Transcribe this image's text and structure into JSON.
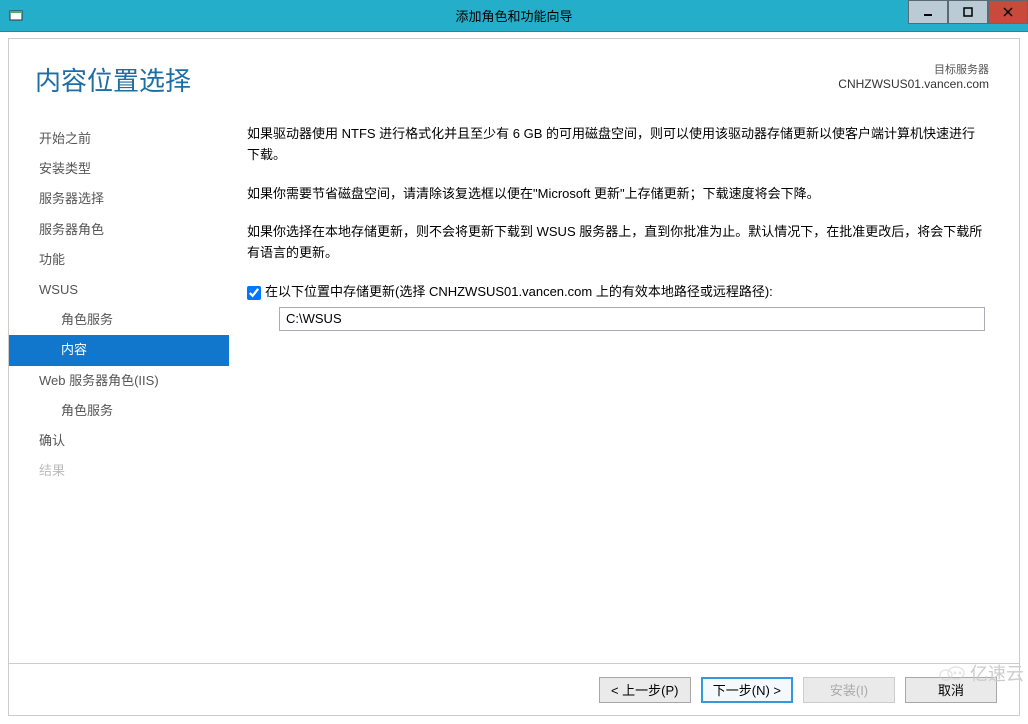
{
  "window": {
    "title": "添加角色和功能向导"
  },
  "header": {
    "page_title": "内容位置选择",
    "server_label": "目标服务器",
    "server_name": "CNHZWSUS01.vancen.com"
  },
  "sidebar": {
    "items": [
      {
        "label": "开始之前",
        "nested": false,
        "selected": false,
        "disabled": false
      },
      {
        "label": "安装类型",
        "nested": false,
        "selected": false,
        "disabled": false
      },
      {
        "label": "服务器选择",
        "nested": false,
        "selected": false,
        "disabled": false
      },
      {
        "label": "服务器角色",
        "nested": false,
        "selected": false,
        "disabled": false
      },
      {
        "label": "功能",
        "nested": false,
        "selected": false,
        "disabled": false
      },
      {
        "label": "WSUS",
        "nested": false,
        "selected": false,
        "disabled": false
      },
      {
        "label": "角色服务",
        "nested": true,
        "selected": false,
        "disabled": false
      },
      {
        "label": "内容",
        "nested": true,
        "selected": true,
        "disabled": false
      },
      {
        "label": "Web 服务器角色(IIS)",
        "nested": false,
        "selected": false,
        "disabled": false
      },
      {
        "label": "角色服务",
        "nested": true,
        "selected": false,
        "disabled": false
      },
      {
        "label": "确认",
        "nested": false,
        "selected": false,
        "disabled": false
      },
      {
        "label": "结果",
        "nested": false,
        "selected": false,
        "disabled": true
      }
    ]
  },
  "main": {
    "para1": "如果驱动器使用 NTFS 进行格式化并且至少有 6 GB 的可用磁盘空间，则可以使用该驱动器存储更新以使客户端计算机快速进行下载。",
    "para2": "如果你需要节省磁盘空间，请清除该复选框以便在\"Microsoft 更新\"上存储更新；下载速度将会下降。",
    "para3": "如果你选择在本地存储更新，则不会将更新下载到 WSUS 服务器上，直到你批准为止。默认情况下，在批准更改后，将会下载所有语言的更新。",
    "checkbox_label": "在以下位置中存储更新(选择 CNHZWSUS01.vancen.com 上的有效本地路径或远程路径):",
    "checkbox_checked": true,
    "path_value": "C:\\WSUS"
  },
  "buttons": {
    "previous": "< 上一步(P)",
    "next": "下一步(N) >",
    "install": "安装(I)",
    "cancel": "取消"
  },
  "watermark": "亿速云"
}
